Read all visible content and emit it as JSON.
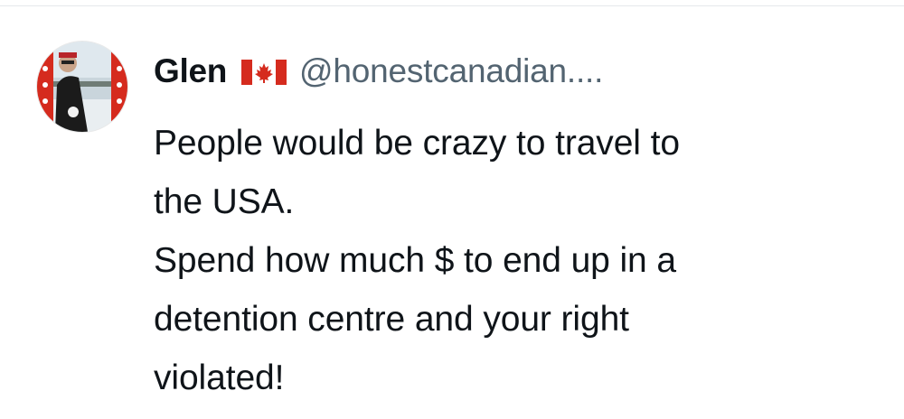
{
  "author": {
    "display_name": "Glen",
    "flag_icon": "canada-flag-icon",
    "handle": "@honestcanadian...."
  },
  "tweet": {
    "lines": [
      "People would be crazy to travel to",
      "the USA.",
      "Spend how much $ to end up in a",
      "detention centre and your right",
      "violated!"
    ]
  },
  "colors": {
    "text_primary": "#0f1419",
    "text_secondary": "#536471",
    "flag_red": "#d52b1e",
    "background": "#ffffff"
  }
}
